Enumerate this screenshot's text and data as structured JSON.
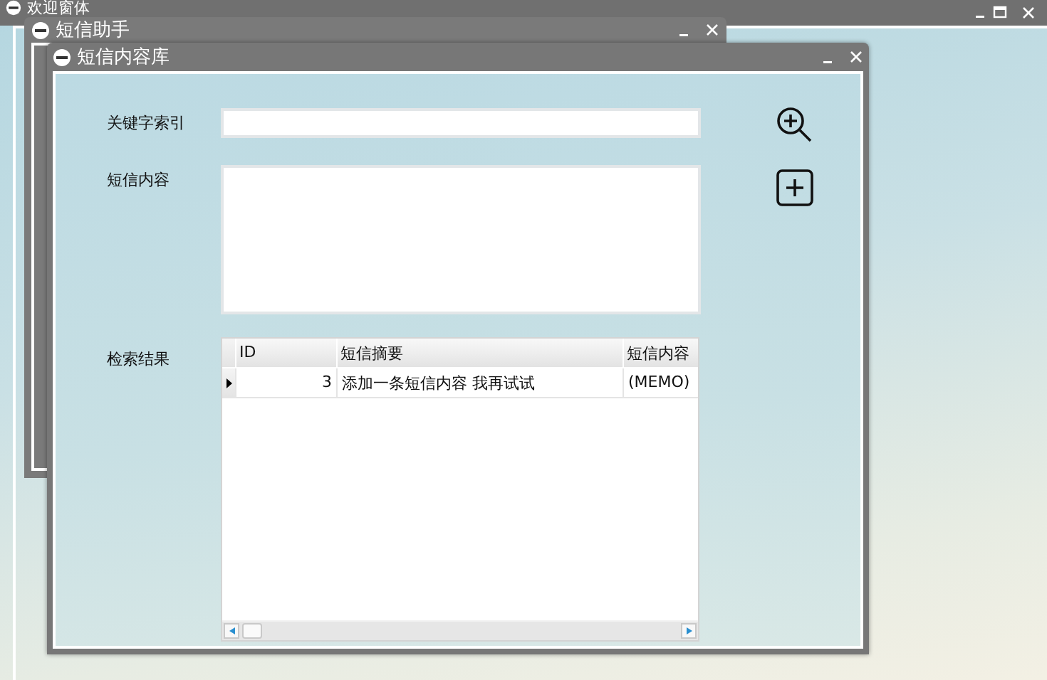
{
  "windows": [
    {
      "title": "欢迎窗体",
      "maximizable": true
    },
    {
      "title": "短信助手",
      "maximizable": false
    },
    {
      "title": "短信内容库",
      "maximizable": false
    }
  ],
  "form": {
    "keyword_label": "关键字索引",
    "content_label": "短信内容",
    "results_label": "检索结果"
  },
  "results": {
    "columns": [
      "ID",
      "短信摘要",
      "短信内容"
    ],
    "rows": [
      {
        "id": "3",
        "summary": "添加一条短信内容 我再试试",
        "content": "(MEMO)",
        "current": true
      }
    ]
  }
}
